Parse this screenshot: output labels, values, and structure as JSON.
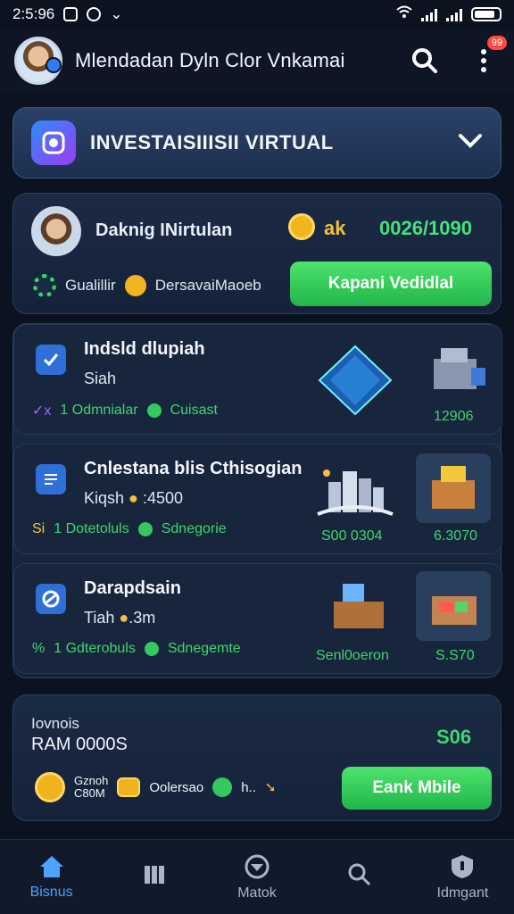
{
  "status_bar": {
    "time": "2:5:96"
  },
  "header": {
    "title": "Mlendadan Dyln Clor Vnkamai",
    "badge": "99"
  },
  "invest": {
    "label": "INVESTAISIIISII VIRTUAL"
  },
  "profile": {
    "name": "Daknig INirtulan",
    "currency": "ak",
    "balance": "0026/1090",
    "stat1": "Gualillir",
    "stat2": "DersavaiMaoeb",
    "cta": "Kapani Vedidlal"
  },
  "items": [
    {
      "title": "Indsld dlupiah",
      "sub": "Siah",
      "meta_prefix": "✓x",
      "meta1": "1 Odmnialar",
      "meta2": "Cuisast",
      "value": "12906"
    },
    {
      "title": "Cnlestana blis Cthisogian",
      "sub": "Kiqsh",
      "sub_extra": ":4500",
      "meta_prefix": "Si",
      "meta1": "1 Dotetoluls",
      "meta2": "Sdnegorie",
      "value1": "S00 0304",
      "value2": "6.3070"
    },
    {
      "title": "Darapdsain",
      "sub": "Tiah",
      "sub_extra": ".3m",
      "meta_prefix": "%",
      "meta1": "1 Gdterobuls",
      "meta2": "Sdnegemte",
      "value1": "Senl0oeron",
      "value2": "S.S70"
    }
  ],
  "wallet": {
    "caption": "Iovnois",
    "ram": "RAM 0000S",
    "amount": "S06",
    "coin_top": "Gznoh",
    "coin_bottom": "C80M",
    "label2": "Oolersao",
    "label3": "h..",
    "cta": "Eank Mbile"
  },
  "nav": [
    {
      "label": "Bisnus",
      "icon": "home-icon"
    },
    {
      "label": "",
      "icon": "bars-icon"
    },
    {
      "label": "Matok",
      "icon": "compass-icon"
    },
    {
      "label": "",
      "icon": "search-icon"
    },
    {
      "label": "Idmgant",
      "icon": "shield-icon"
    }
  ],
  "colors": {
    "accent_green": "#35c85e",
    "accent_blue": "#4da3ff",
    "bg": "#0b1220"
  }
}
